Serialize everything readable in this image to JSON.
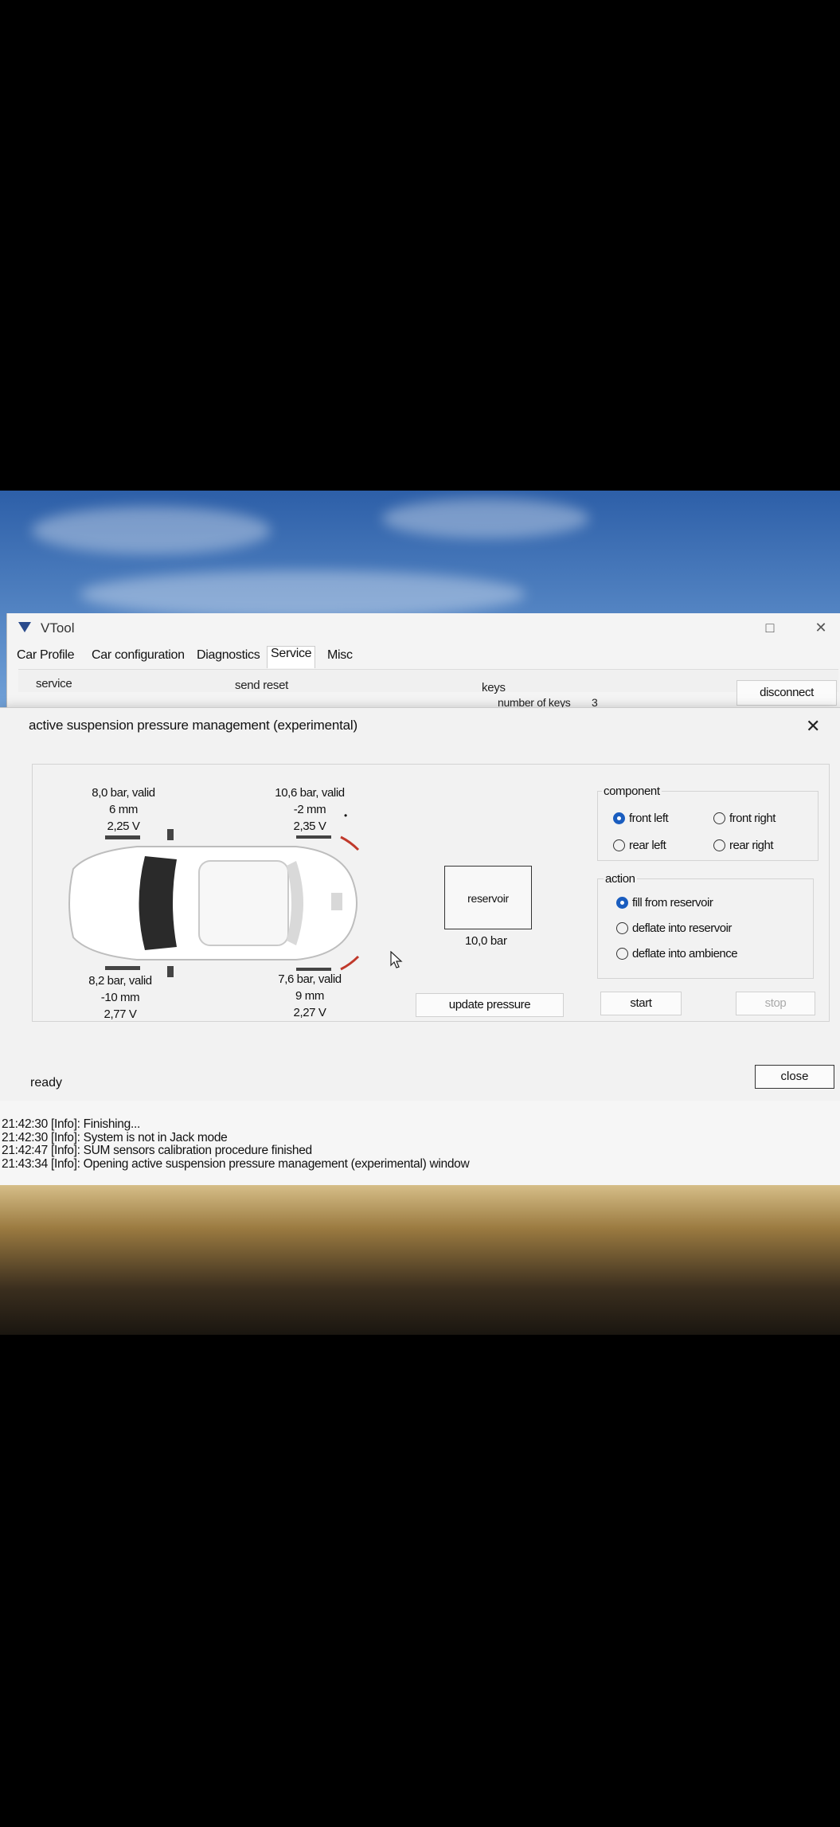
{
  "app": {
    "title": "VTool"
  },
  "menu": [
    "Car Profile",
    "Car configuration",
    "Diagnostics",
    "Service",
    "Misc"
  ],
  "service_tab": {
    "service_label": "service",
    "send_reset_label": "send reset",
    "keys_label": "keys",
    "number_of_keys_label": "number of keys",
    "number_of_keys_value": "3",
    "disconnect_label": "disconnect"
  },
  "dialog": {
    "title": "active suspension pressure management (experimental)",
    "front_left": {
      "pressure": "8,0 bar, valid",
      "height": "6 mm",
      "voltage": "2,25 V"
    },
    "front_right": {
      "pressure": "10,6 bar, valid",
      "height": "-2 mm",
      "voltage": "2,35 V"
    },
    "rear_left": {
      "pressure": "8,2 bar, valid",
      "height": "-10 mm",
      "voltage": "2,77 V"
    },
    "rear_right": {
      "pressure": "7,6 bar, valid",
      "height": "9 mm",
      "voltage": "2,27 V"
    },
    "reservoir_label": "reservoir",
    "reservoir_value": "10,0 bar",
    "update_pressure_label": "update pressure",
    "component": {
      "label": "component",
      "options": [
        "front left",
        "front right",
        "rear left",
        "rear right"
      ],
      "selected": "front left"
    },
    "action": {
      "label": "action",
      "options": [
        "fill from reservoir",
        "deflate into reservoir",
        "deflate into ambience"
      ],
      "selected": "fill from reservoir"
    },
    "start_label": "start",
    "stop_label": "stop",
    "status": "ready",
    "close_label": "close"
  },
  "log": [
    "21:42:30 [Info]: Finishing...",
    "21:42:30 [Info]: System is not in Jack mode",
    "21:42:47 [Info]: SUM sensors calibration procedure finished",
    "21:43:34 [Info]: Opening active suspension pressure management (experimental) window"
  ],
  "colors": {
    "accent": "#1a5dbf",
    "logo": "#2a4b8c",
    "highlight": "#c0392b"
  }
}
